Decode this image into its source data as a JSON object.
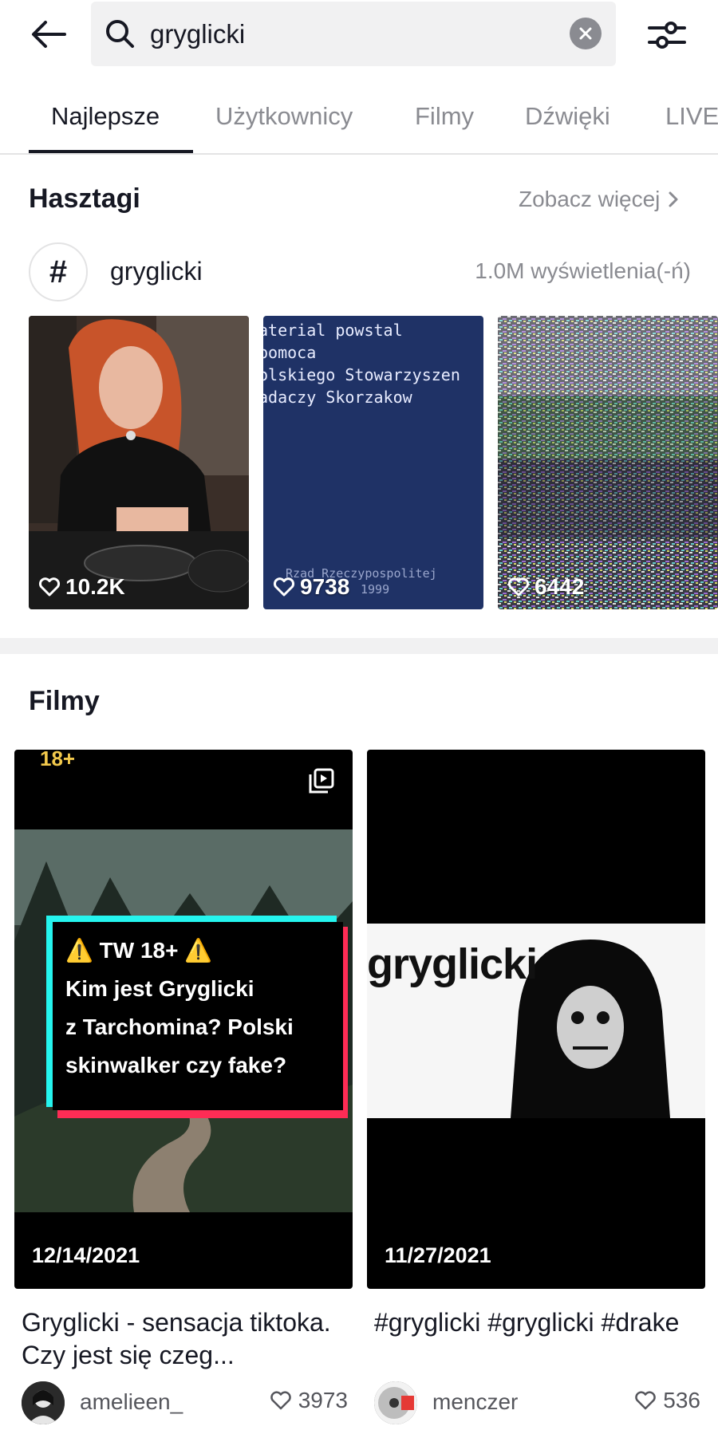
{
  "search": {
    "query": "gryglicki"
  },
  "tabs": [
    {
      "label": "Najlepsze"
    },
    {
      "label": "Użytkownicy"
    },
    {
      "label": "Filmy"
    },
    {
      "label": "Dźwięki"
    },
    {
      "label": "LIVE"
    }
  ],
  "hashtags": {
    "title": "Hasztagi",
    "see_more": "Zobacz więcej",
    "tag": {
      "name": "gryglicki",
      "views": "1.0M wyświetlenia(-ń)"
    },
    "thumbs": [
      {
        "likes": "10.2K"
      },
      {
        "likes": "9738",
        "screen_text": [
          "aterial powstal",
          "pomoca",
          "olskiego Stowarzyszen",
          "adaczy Skorzakow"
        ],
        "footer_text": "Rzad Rzeczypospolitej",
        "footer_year": "1999"
      },
      {
        "likes": "6442"
      }
    ]
  },
  "films": {
    "title": "Filmy",
    "items": [
      {
        "badge": "18+",
        "overlay_lines": [
          "⚠️ TW 18+ ⚠️",
          "Kim jest Gryglicki",
          "z Tarchomina? Polski",
          "skinwalker czy fake?"
        ],
        "date": "12/14/2021",
        "description": "Gryglicki - sensacja tiktoka. Czy jest się czeg...",
        "author": "amelieen_",
        "likes": "3973"
      },
      {
        "overlay_word": "gryglicki",
        "date": "11/27/2021",
        "description": "#gryglicki #gryglicki #drake",
        "author": "menczer",
        "likes": "536"
      }
    ]
  },
  "colors": {
    "primary_text": "#161823",
    "secondary_text": "#8a8b91",
    "search_bg": "#f1f1f2",
    "accent_cyan": "#25f4ee",
    "accent_red": "#fe2c55"
  }
}
